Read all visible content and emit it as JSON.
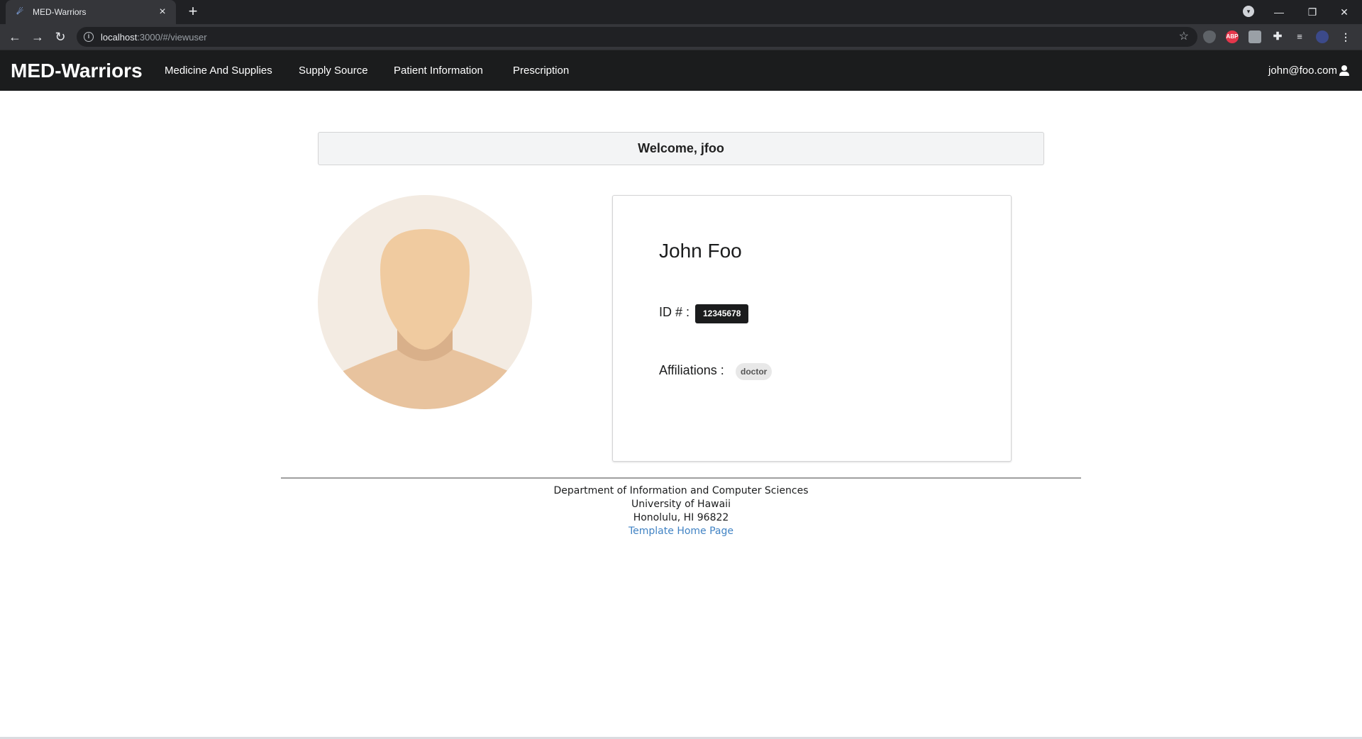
{
  "browser": {
    "tab_title": "MED-Warriors",
    "tab_favicon": "meteor-icon",
    "url_host": "localhost",
    "url_rest": ":3000/#/viewuser",
    "extensions": [
      {
        "name": "shield-extension-icon",
        "label": "",
        "color": "#5f6368"
      },
      {
        "name": "adblock-extension-icon",
        "label": "ABP",
        "color": "#e5364b"
      },
      {
        "name": "grid-extension-icon",
        "label": "",
        "color": "#9aa0a6"
      },
      {
        "name": "puzzle-extensions-icon",
        "label": "",
        "color": "#35363a"
      },
      {
        "name": "media-queue-icon",
        "label": "",
        "color": "#35363a"
      },
      {
        "name": "profile-avatar-icon",
        "label": "",
        "color": "#3c4a8a"
      }
    ]
  },
  "navbar": {
    "brand": "MED-Warriors",
    "links": [
      "Medicine And Supplies",
      "Supply Source",
      "Patient Information",
      "Prescription"
    ],
    "user_email": "john@foo.com"
  },
  "welcome": "Welcome, jfoo",
  "profile": {
    "name": "John Foo",
    "id_label": "ID # :",
    "id_value": "12345678",
    "affiliations_label": "Affiliations :",
    "affiliation": "doctor"
  },
  "footer": {
    "line1": "Department of Information and Computer Sciences",
    "line2": "University of Hawaii",
    "line3": "Honolulu, HI 96822",
    "link_text": "Template Home Page"
  },
  "colors": {
    "navbar_bg": "#1b1c1d",
    "link_blue": "#4183c4",
    "avatar_bg": "#f3ebe2",
    "avatar_skin": "#f0cba0"
  }
}
